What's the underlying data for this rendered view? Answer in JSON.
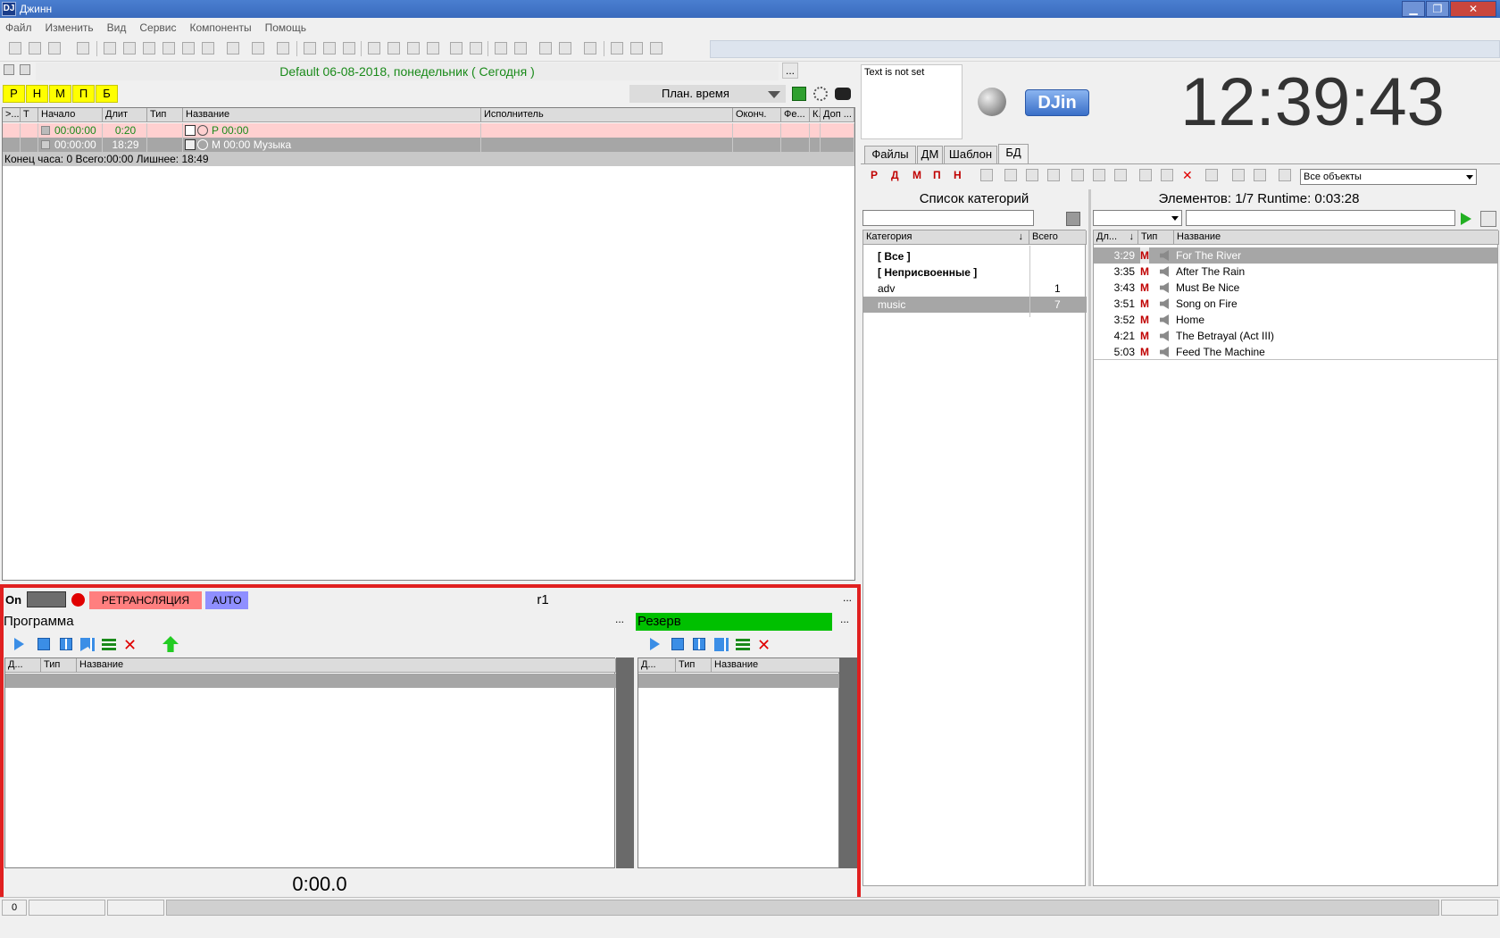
{
  "window": {
    "title": "Джинн",
    "app_icon": "DJ",
    "minimize": "▁",
    "restore": "❐",
    "close": "✕"
  },
  "menu": [
    "Файл",
    "Изменить",
    "Вид",
    "Сервис",
    "Компоненты",
    "Помощь"
  ],
  "playlist": {
    "title": "Default 06-08-2018, понедельник ( Сегодня )",
    "more": "...",
    "letters": [
      "Р",
      "Н",
      "М",
      "П",
      "Б"
    ],
    "plan_time": "План. время",
    "columns": [
      ">...",
      "Т",
      "Начало",
      "Длит",
      "Тип",
      "Название",
      "Исполнитель",
      "Оконч.",
      "Фе...",
      "К...",
      "Доп ..."
    ],
    "rows": [
      {
        "start": "00:00:00",
        "duration": "0:20",
        "name": "Р 00:00"
      },
      {
        "start": "00:00:00",
        "duration": "18:29",
        "name": "М 00:00 Музыка"
      }
    ],
    "summary": "Конец часа: 0 Всего:00:00 Лишнее: 18:49"
  },
  "player": {
    "on": "On",
    "retrans": "РЕТРАНСЛЯЦИЯ",
    "auto": "AUTO",
    "channel": "r1",
    "more": "...",
    "program": "Программа",
    "reserve": "Резерв",
    "col_dur": "Д...",
    "col_type": "Тип",
    "col_name": "Название",
    "time": "0:00.0"
  },
  "top_right": {
    "text_not_set": "Text is not set",
    "logo": "DJin",
    "clock": "12:39:43"
  },
  "tabs": [
    "Файлы",
    "ДМ",
    "Шаблон",
    "БД"
  ],
  "db": {
    "filter": "Все объекты",
    "categories_title": "Список категорий",
    "elements_title": "Элементов: 1/7   Runtime: 0:03:28",
    "cat_col": "Категория",
    "total_col": "Всего",
    "categories": [
      {
        "name": "[ Все ]",
        "count": ""
      },
      {
        "name": "[ Неприсвоенные ]",
        "count": ""
      },
      {
        "name": "adv",
        "count": "1"
      },
      {
        "name": "music",
        "count": "7"
      }
    ],
    "el_col_dur": "Дл...",
    "el_col_type": "Тип",
    "el_col_name": "Название",
    "type_letter": "М",
    "elements": [
      {
        "dur": "3:29",
        "name": "For The River"
      },
      {
        "dur": "3:35",
        "name": "After The Rain"
      },
      {
        "dur": "3:43",
        "name": "Must Be Nice"
      },
      {
        "dur": "3:51",
        "name": "Song on Fire"
      },
      {
        "dur": "3:52",
        "name": "Home"
      },
      {
        "dur": "4:21",
        "name": "The Betrayal (Act III)"
      },
      {
        "dur": "5:03",
        "name": "Feed The Machine"
      }
    ]
  },
  "status": {
    "left": "0"
  },
  "colors": {
    "highlight": "#e02020",
    "retrans": "#ff7f7f",
    "auto": "#8f8fff",
    "reserve": "#00c000",
    "letters": "#ffff00",
    "title_green": "#1a8a1a"
  }
}
